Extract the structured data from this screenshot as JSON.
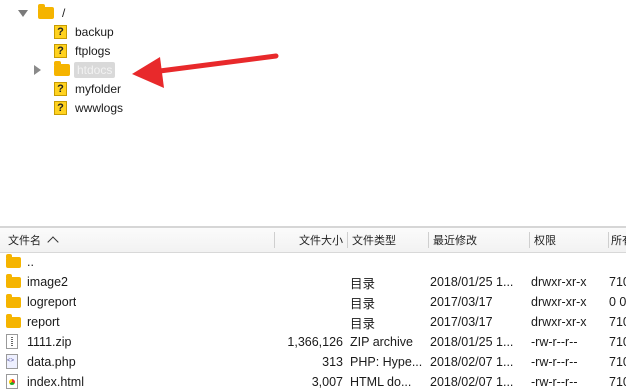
{
  "tree": {
    "root": {
      "label": "/"
    },
    "children": [
      {
        "label": "backup",
        "icon": "question-folder-icon"
      },
      {
        "label": "ftplogs",
        "icon": "question-folder-icon"
      },
      {
        "label": "htdocs",
        "icon": "folder-icon",
        "selected": true
      },
      {
        "label": "myfolder",
        "icon": "question-folder-icon"
      },
      {
        "label": "wwwlogs",
        "icon": "question-folder-icon"
      }
    ],
    "annotation_arrow_color": "#e8292b"
  },
  "file_list": {
    "columns": {
      "name": "文件名",
      "size": "文件大小",
      "type": "文件类型",
      "modified": "最近修改",
      "permissions": "权限",
      "owner": "所有"
    },
    "rows": [
      {
        "name": "..",
        "size": "",
        "type": "",
        "modified": "",
        "permissions": "",
        "owner": "",
        "icon": "folder-icon"
      },
      {
        "name": "image2",
        "size": "",
        "type": "目录",
        "modified": "2018/01/25 1...",
        "permissions": "drwxr-xr-x",
        "owner": "710",
        "icon": "folder-icon"
      },
      {
        "name": "logreport",
        "size": "",
        "type": "目录",
        "modified": "2017/03/17",
        "permissions": "drwxr-xr-x",
        "owner": "0 0",
        "icon": "folder-icon"
      },
      {
        "name": "report",
        "size": "",
        "type": "目录",
        "modified": "2017/03/17",
        "permissions": "drwxr-xr-x",
        "owner": "710",
        "icon": "folder-icon"
      },
      {
        "name": "1111.zip",
        "size": "1,366,126",
        "type": "ZIP archive",
        "modified": "2018/01/25 1...",
        "permissions": "-rw-r--r--",
        "owner": "710",
        "icon": "zip-file-icon"
      },
      {
        "name": "data.php",
        "size": "313",
        "type": "PHP: Hype...",
        "modified": "2018/02/07 1...",
        "permissions": "-rw-r--r--",
        "owner": "710",
        "icon": "php-file-icon"
      },
      {
        "name": "index.html",
        "size": "3,007",
        "type": "HTML do...",
        "modified": "2018/02/07 1...",
        "permissions": "-rw-r--r--",
        "owner": "710",
        "icon": "html-file-icon"
      }
    ]
  }
}
